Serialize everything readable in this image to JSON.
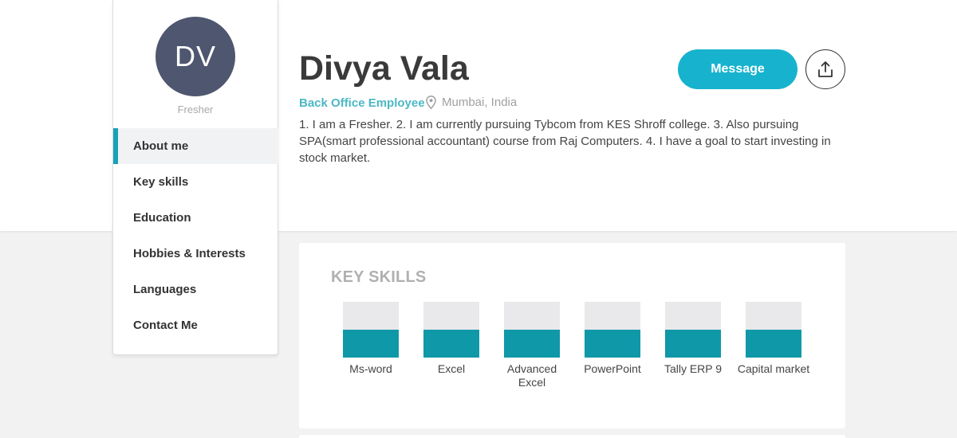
{
  "profile": {
    "initials": "DV",
    "status": "Fresher",
    "name": "Divya Vala",
    "role": "Back Office Employee",
    "location": "Mumbai, India",
    "about": "1. I am a Fresher. 2. I am currently pursuing Tybcom from KES Shroff college. 3. Also pursuing SPA(smart professional accountant) course from Raj Computers. 4. I have a goal to start investing in stock market."
  },
  "actions": {
    "message_label": "Message",
    "share_icon": "share-icon"
  },
  "sidebar": {
    "items": [
      {
        "label": "About me",
        "active": true
      },
      {
        "label": "Key skills",
        "active": false
      },
      {
        "label": "Education",
        "active": false
      },
      {
        "label": "Hobbies & Interests",
        "active": false
      },
      {
        "label": "Languages",
        "active": false
      },
      {
        "label": "Contact Me",
        "active": false
      }
    ]
  },
  "key_skills": {
    "title": "KEY SKILLS",
    "skills": [
      {
        "name": "Ms-word",
        "level": 0.5
      },
      {
        "name": "Excel",
        "level": 0.5
      },
      {
        "name": "Advanced Excel",
        "level": 0.5
      },
      {
        "name": "PowerPoint",
        "level": 0.5
      },
      {
        "name": "Tally ERP 9",
        "level": 0.5
      },
      {
        "name": "Capital market",
        "level": 0.5
      }
    ]
  },
  "colors": {
    "accent": "#17b3ce",
    "avatar_bg": "#4f5670",
    "skill_fill": "#0f98a8",
    "role_text": "#4cb8c4"
  }
}
